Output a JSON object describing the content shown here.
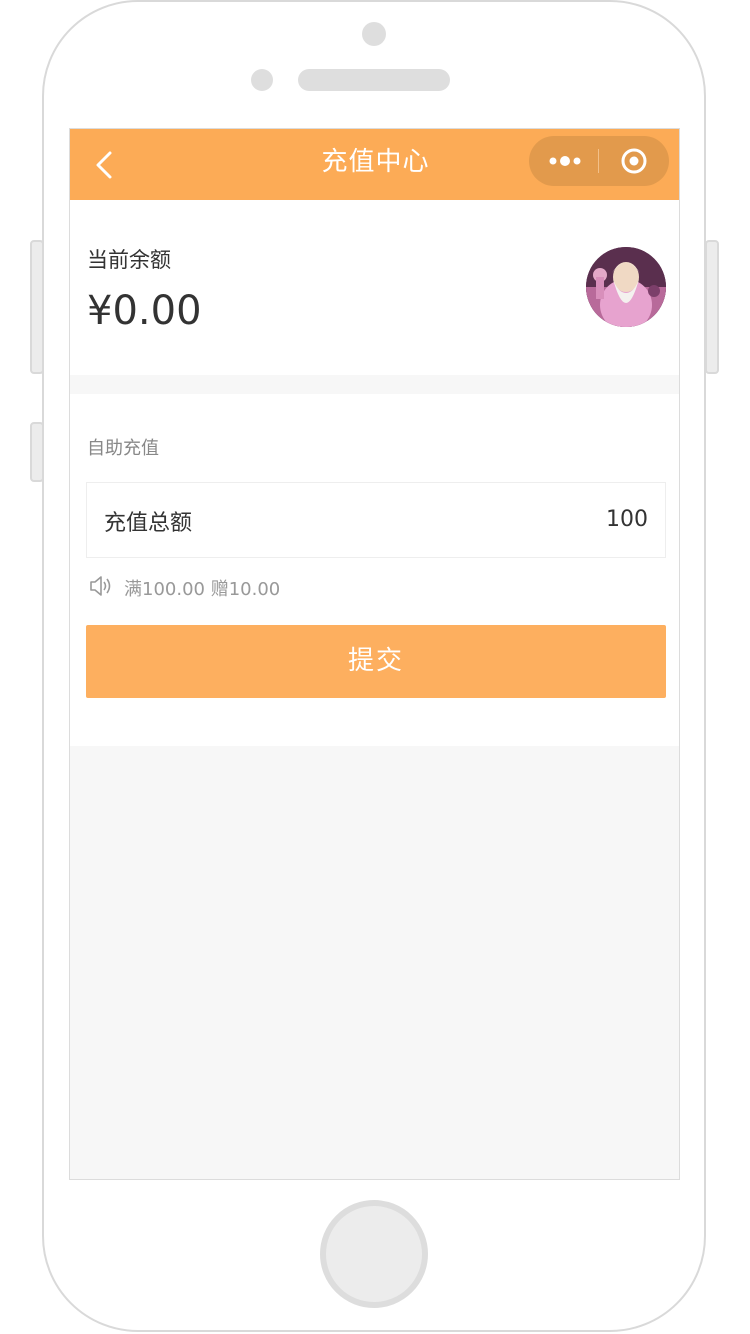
{
  "colors": {
    "brand": "#fcab56",
    "button": "#fdaf5f",
    "page_bg": "#f7f7f7",
    "text": "#333333",
    "muted": "#999999"
  },
  "navbar": {
    "title": "充值中心",
    "back_icon": "chevron-left-icon",
    "more_icon": "more-dots-icon",
    "close_icon": "target-circle-icon"
  },
  "balance": {
    "label": "当前余额",
    "value": "¥0.00",
    "avatar": "user-avatar"
  },
  "recharge": {
    "section_title": "自助充值",
    "amount_label": "充值总额",
    "amount_value": "100",
    "promo_icon": "speaker-icon",
    "promo_text": "满100.00 赠10.00",
    "submit_label": "提交"
  }
}
